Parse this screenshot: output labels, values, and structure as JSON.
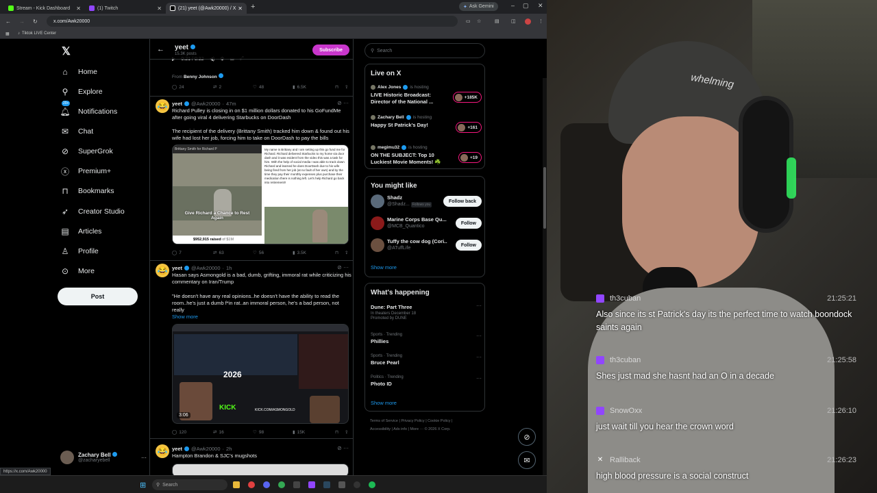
{
  "browser": {
    "tabs": [
      {
        "label": "Stream - Kick Dashboard",
        "color": "#53fc18"
      },
      {
        "label": "(1) Twitch",
        "color": "#9146ff"
      },
      {
        "label": "(21) yeet (@Awk20000) / X",
        "color": "#ffffff"
      }
    ],
    "ask_gemini": "Ask Gemini",
    "url": "x.com/Awk20000",
    "bookmark": "Tiktok LIVE Center",
    "status_url": "https://x.com/Awk20000"
  },
  "nav": {
    "items": [
      {
        "label": "Home",
        "icon": "home-icon"
      },
      {
        "label": "Explore",
        "icon": "search-icon"
      },
      {
        "label": "Notifications",
        "icon": "bell-icon",
        "badge": "20+"
      },
      {
        "label": "Chat",
        "icon": "mail-icon"
      },
      {
        "label": "SuperGrok",
        "icon": "grok-icon"
      },
      {
        "label": "Premium+",
        "icon": "x-circle-icon"
      },
      {
        "label": "Bookmarks",
        "icon": "bookmark-icon"
      },
      {
        "label": "Creator Studio",
        "icon": "rocket-icon"
      },
      {
        "label": "Articles",
        "icon": "article-icon"
      },
      {
        "label": "Profile",
        "icon": "person-icon"
      },
      {
        "label": "More",
        "icon": "more-circle-icon"
      }
    ],
    "post": "Post",
    "account": {
      "name": "Zachary Bell",
      "handle": "@zacharyebell"
    }
  },
  "profile": {
    "name": "yeet",
    "posts": "15.3K posts",
    "subscribe": "Subscribe"
  },
  "tweets": [
    {
      "id": "t0",
      "video_time": "0:21 / 0:32",
      "from_label": "From",
      "from_name": "Benny Johnson",
      "replies": "24",
      "retweets": "2",
      "likes": "48",
      "views": "6.5K"
    },
    {
      "id": "t1",
      "name": "yeet",
      "handle": "@Awk20000",
      "time": "47m",
      "text1": "Richard Pulley is closing in on $1 million dollars donated to his GoFundMe after going viral 4 delivering Starbucks on DoorDash",
      "text2": "The recipient of the delivery (Brittany Smith) tracked him down & found out his wife had lost her job, forcing him to take on DoorDash to pay the bills",
      "media_caption": "Give Richard a Chance to Rest Again",
      "media_for": "Brittany Smith for Richard P",
      "media_raised": "$952,915 raised",
      "media_of": "of $1M",
      "media_letter": "My name is Brittany and I am setting up this go fund me for Richard. Richard delivered Starbucks to my home via door dash and it was evident from the video this was a task for him. With the help of social media I was able to track down Richard and learned he does DoorDash due to his wife being fired from her job (at no fault of her own) and by the time they pay their monthly expenses plus purchase their medication there is nothing left. Let's help Richard go back into retirement!!",
      "replies": "7",
      "retweets": "63",
      "likes": "56",
      "views": "3.5K"
    },
    {
      "id": "t2",
      "name": "yeet",
      "handle": "@Awk20000",
      "time": "1h",
      "text1": "Hasan says Asmongold is a bad, dumb, grifting, immoral rat while criticizing his commentary on Iran/Trump",
      "text2": "\"He doesn't have any real opinions..he doesn't have the ability to read the room..he's just a dumb f*in rat..an immoral person, he's a bad person, not really",
      "show_more": "Show more",
      "media_year": "2026",
      "media_kick": "KICK",
      "media_kick_url": "KICK.COM/ASMONGOLD",
      "duration": "3:06",
      "replies": "120",
      "retweets": "16",
      "likes": "98",
      "views": "15K"
    },
    {
      "id": "t3",
      "name": "yeet",
      "handle": "@Awk20000",
      "time": "2h",
      "text1": "Hampton Brandon & SJC's mugshots"
    }
  ],
  "search": {
    "placeholder": "Search"
  },
  "live": {
    "title": "Live on X",
    "hosting": "is hosting",
    "items": [
      {
        "host": "Alex Jones",
        "title": "LIVE Historic Broadcast: Director of the National ...",
        "count": "+185K"
      },
      {
        "host": "Zachary Bell",
        "title": "Happy St Patrick's Day!",
        "count": "+161"
      },
      {
        "host": "megimu32",
        "title": "ON THE SUBJECT: Top 10 Luckiest Movie Moments! ☘️",
        "count": "+19"
      }
    ]
  },
  "might_like": {
    "title": "You might like",
    "items": [
      {
        "name": "Shadz",
        "handle": "@Shadz...",
        "follows_you": "Follows you",
        "button": "Follow back",
        "color": "#5a6a7a"
      },
      {
        "name": "Marine Corps Base Qu...",
        "handle": "@MCB_Quantico",
        "button": "Follow",
        "color": "#8b1a1a"
      },
      {
        "name": "Tuffy the cow dog (Cori...",
        "handle": "@ATuffLife",
        "button": "Follow",
        "color": "#6b5040"
      }
    ],
    "show_more": "Show more"
  },
  "happening": {
    "title": "What's happening",
    "items": [
      {
        "category": "",
        "name": "Dune: Part Three",
        "sub": "In theaters December 18",
        "promo": "Promoted by DUNE"
      },
      {
        "category": "Sports · Trending",
        "name": "Phillies"
      },
      {
        "category": "Sports · Trending",
        "name": "Bruce Pearl"
      },
      {
        "category": "Politics · Trending",
        "name": "Photo ID"
      }
    ],
    "show_more": "Show more"
  },
  "footer": {
    "line1": "Terms of Service  |  Privacy Policy  |  Cookie Policy  |",
    "line2": "Accessibility  |  Ads info  |  More ···  © 2026 X Corp."
  },
  "taskbar": {
    "search": "Search"
  },
  "chat": [
    {
      "user": "th3cuban",
      "time": "21:25:21",
      "text": "Also since its st Patrick's day its the perfect time to watch boondock saints again",
      "platform": "twitch"
    },
    {
      "user": "th3cuban",
      "time": "21:25:58",
      "text": "Shes just mad she hasnt had an O in a decade",
      "platform": "twitch"
    },
    {
      "user": "SnowOxx",
      "time": "21:26:10",
      "text": "just wait till you hear the crown word",
      "platform": "twitch"
    },
    {
      "user": "Ralliback",
      "time": "21:26:23",
      "text": "high blood pressure is a social construct",
      "platform": "x"
    }
  ],
  "cap_text": "whelming"
}
